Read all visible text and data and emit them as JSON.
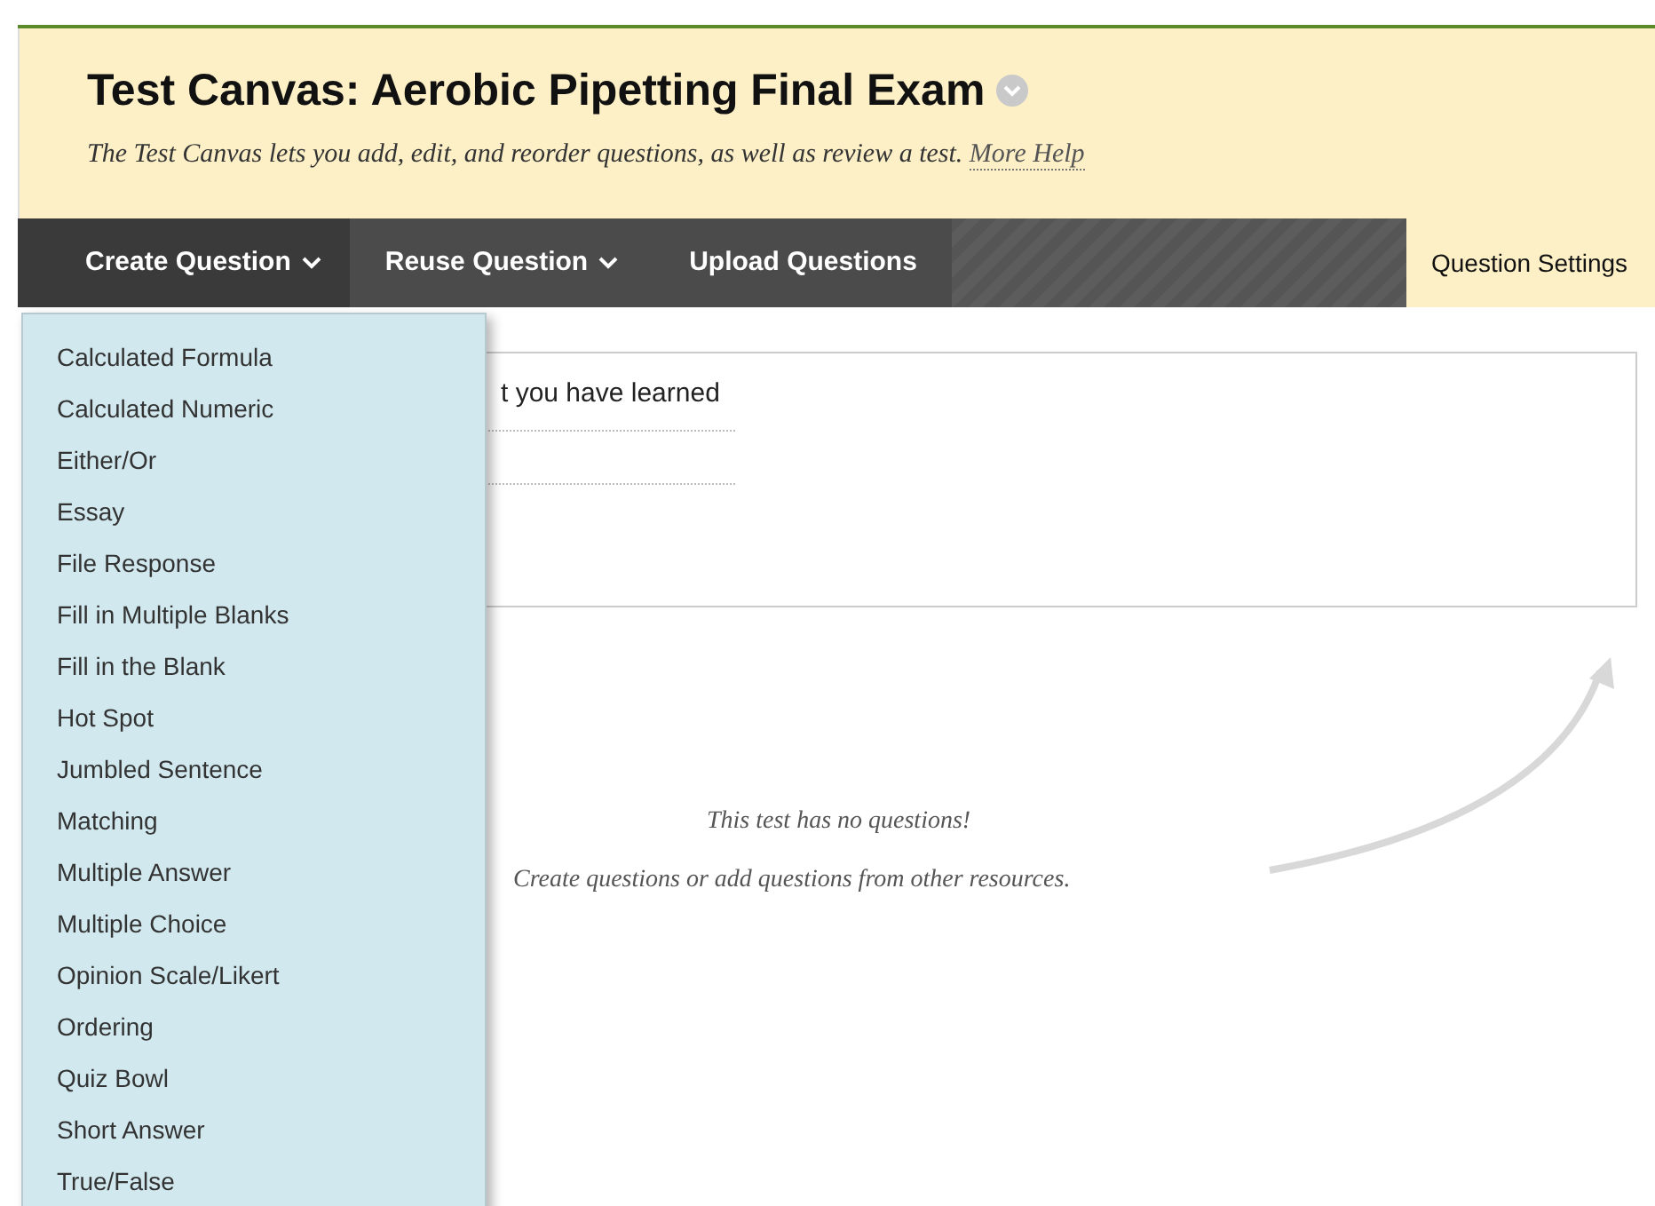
{
  "header": {
    "title": "Test Canvas: Aerobic Pipetting Final Exam",
    "description": "The Test Canvas lets you add, edit, and reorder questions, as well as review a test.",
    "help_link": "More Help"
  },
  "toolbar": [
    {
      "label": "Create Question",
      "kind": "dropdown",
      "selected": true
    },
    {
      "label": "Reuse Question",
      "kind": "dropdown",
      "selected": false
    },
    {
      "label": "Upload Questions",
      "kind": "plain",
      "selected": false
    },
    {
      "label": "Question Settings",
      "kind": "settings",
      "selected": false
    }
  ],
  "dropdown_menu": [
    "Calculated Formula",
    "Calculated Numeric",
    "Either/Or",
    "Essay",
    "File Response",
    "Fill in Multiple Blanks",
    "Fill in the Blank",
    "Hot Spot",
    "Jumbled Sentence",
    "Matching",
    "Multiple Answer",
    "Multiple Choice",
    "Opinion Scale/Likert",
    "Ordering",
    "Quiz Bowl",
    "Short Answer",
    "True/False"
  ],
  "info_box": {
    "text": "t you have learned"
  },
  "empty_state": {
    "title": "This test has no questions!",
    "hint": "Create questions or add questions from other resources."
  }
}
